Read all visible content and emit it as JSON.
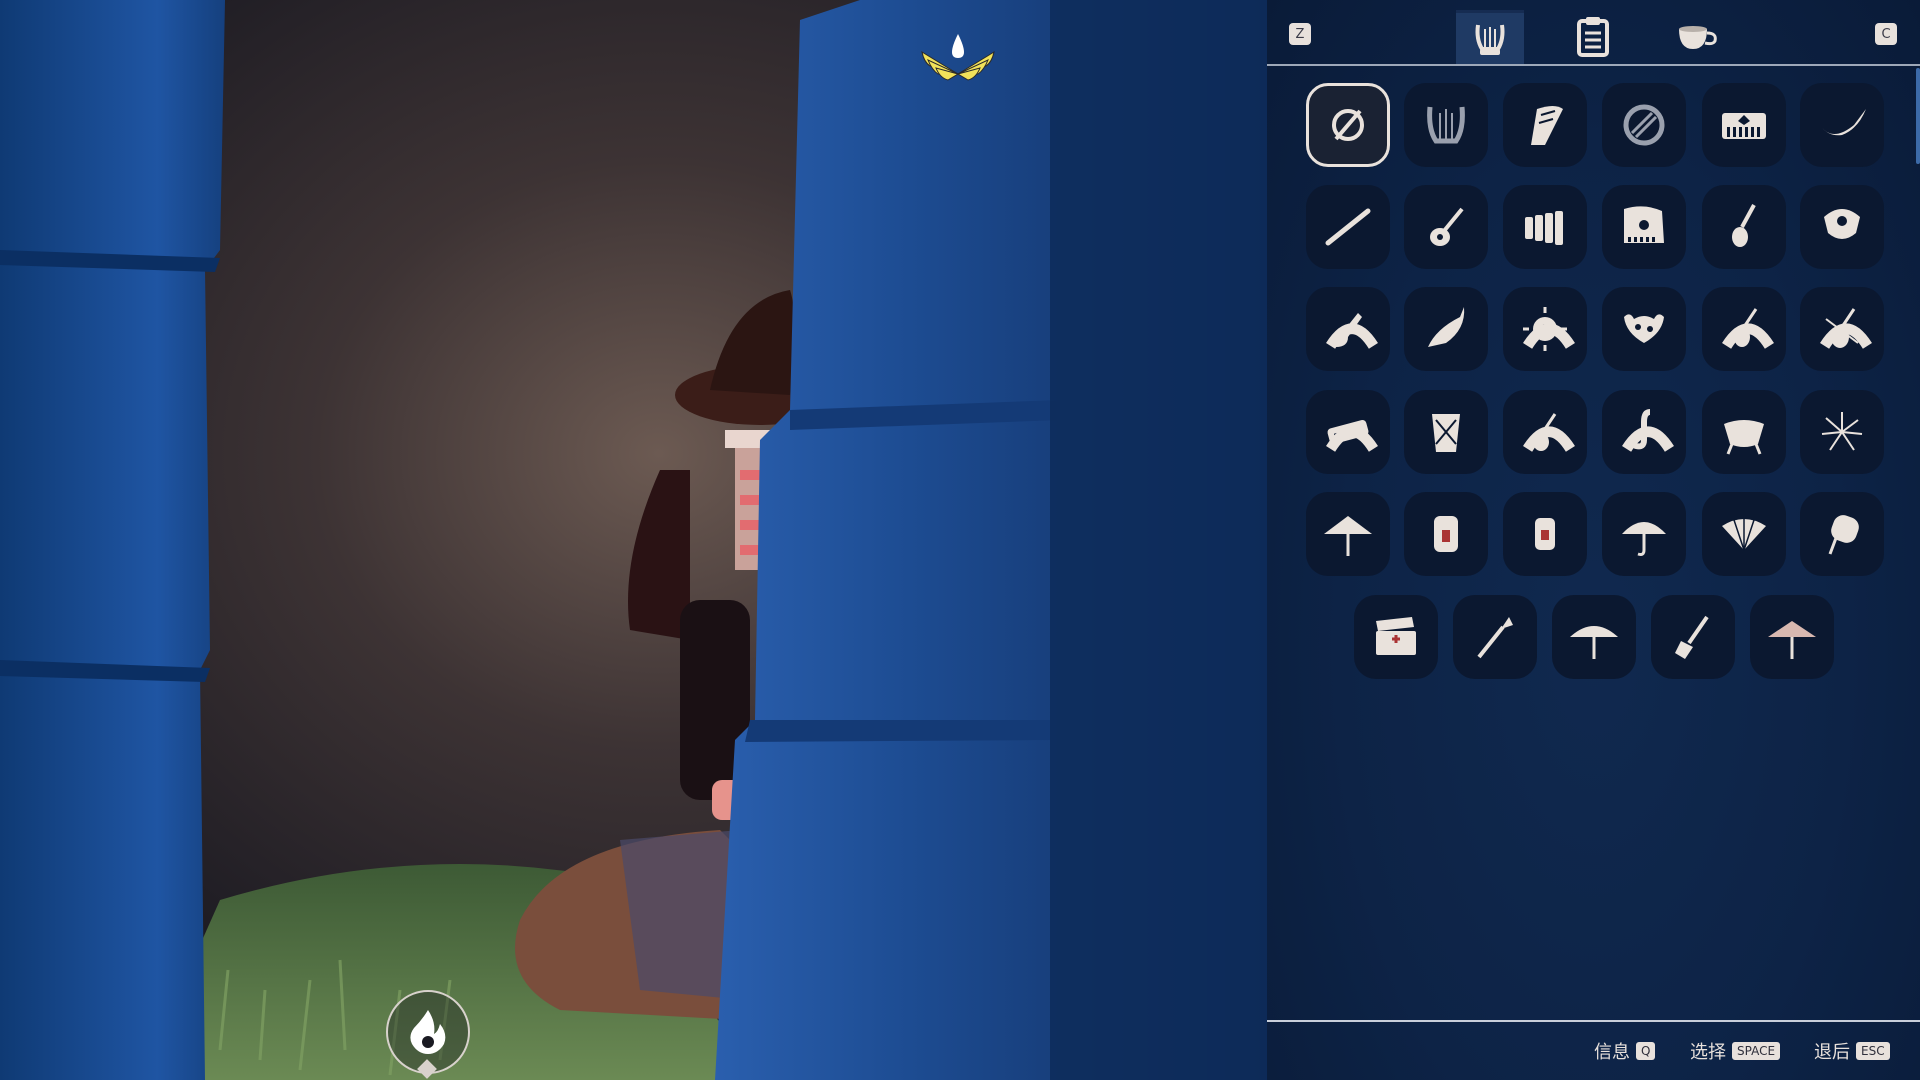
{
  "panel": {
    "left_key": "Z",
    "right_key": "C",
    "tabs": [
      {
        "id": "instruments",
        "icon": "harp-tab-icon",
        "active": true
      },
      {
        "id": "props",
        "icon": "clipboard-tab-icon",
        "active": false
      },
      {
        "id": "food",
        "icon": "teacup-tab-icon",
        "active": false
      }
    ],
    "grid": [
      {
        "icon": "none-icon",
        "selected": true
      },
      {
        "icon": "harp-icon"
      },
      {
        "icon": "winged-harp-icon"
      },
      {
        "icon": "handpan-icon"
      },
      {
        "icon": "piano-keyboard-icon"
      },
      {
        "icon": "horn-icon"
      },
      {
        "icon": "flute-icon"
      },
      {
        "icon": "guitar-icon"
      },
      {
        "icon": "xylophone-icon"
      },
      {
        "icon": "grand-piano-icon"
      },
      {
        "icon": "ukulele-icon"
      },
      {
        "icon": "bell-icon"
      },
      {
        "icon": "electric-guitar-icon",
        "badge": true
      },
      {
        "icon": "horn-alt-icon"
      },
      {
        "icon": "spiked-drum-icon",
        "badge": true
      },
      {
        "icon": "crab-horn-icon"
      },
      {
        "icon": "violin-icon",
        "badge": true
      },
      {
        "icon": "violin-alt-icon",
        "badge": true
      },
      {
        "icon": "harmonica-icon",
        "badge": true
      },
      {
        "icon": "drum-icon"
      },
      {
        "icon": "violin-small-icon",
        "badge": true
      },
      {
        "icon": "saxophone-icon",
        "badge": true
      },
      {
        "icon": "kettle-drum-icon"
      },
      {
        "icon": "firework-icon"
      },
      {
        "icon": "parasol-icon"
      },
      {
        "icon": "lantern-icon"
      },
      {
        "icon": "small-lantern-icon"
      },
      {
        "icon": "umbrella-icon"
      },
      {
        "icon": "fan-icon"
      },
      {
        "icon": "hand-fan-icon"
      },
      {
        "icon": "clapperboard-icon"
      },
      {
        "icon": "torch-icon"
      },
      {
        "icon": "paper-umbrella-icon"
      },
      {
        "icon": "shovel-icon"
      },
      {
        "icon": "lace-umbrella-icon"
      }
    ]
  },
  "hints": [
    {
      "label": "信息",
      "key": "Q"
    },
    {
      "label": "选择",
      "key": "SPACE"
    },
    {
      "label": "退后",
      "key": "ESC"
    }
  ],
  "colors": {
    "panel_bg": "#0d2346",
    "slot_bg": "#0b1830",
    "icon": "#e9e2dc",
    "accent_wing": "#f2e25a"
  }
}
